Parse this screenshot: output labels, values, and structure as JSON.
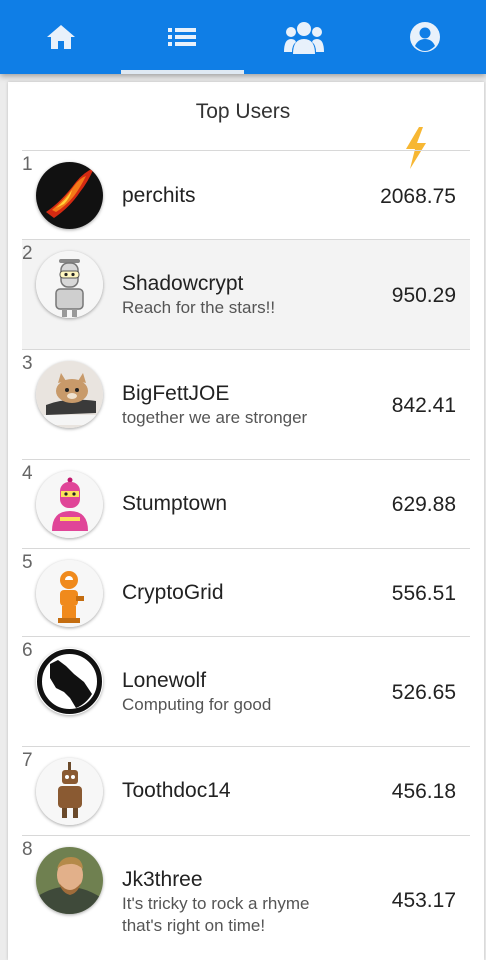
{
  "nav": {
    "tabs": [
      {
        "icon": "home-icon",
        "selected": false
      },
      {
        "icon": "list-icon",
        "selected": true
      },
      {
        "icon": "team-icon",
        "selected": false
      },
      {
        "icon": "account-icon",
        "selected": false
      }
    ]
  },
  "page": {
    "title": "Top Users",
    "score_column_icon": "lightning-icon"
  },
  "users": [
    {
      "rank": "1",
      "name": "perchits",
      "motto": "",
      "score": "2068.75",
      "avatar": "flame-avatar"
    },
    {
      "rank": "2",
      "name": "Shadowcrypt",
      "motto": "Reach for the stars!!",
      "score": "950.29",
      "avatar": "robot-avatar"
    },
    {
      "rank": "3",
      "name": "BigFettJOE",
      "motto": "together we are stronger",
      "score": "842.41",
      "avatar": "cat-avatar"
    },
    {
      "rank": "4",
      "name": "Stumptown",
      "motto": "",
      "score": "629.88",
      "avatar": "pink-robot-avatar"
    },
    {
      "rank": "5",
      "name": "CryptoGrid",
      "motto": "",
      "score": "556.51",
      "avatar": "orange-robot-avatar"
    },
    {
      "rank": "6",
      "name": "Lonewolf",
      "motto": "Computing for good",
      "score": "526.65",
      "avatar": "wolf-avatar"
    },
    {
      "rank": "7",
      "name": "Toothdoc14",
      "motto": "",
      "score": "456.18",
      "avatar": "brown-robot-avatar"
    },
    {
      "rank": "8",
      "name": "Jk3three",
      "motto": "It's tricky to rock a rhyme that's right on time!",
      "score": "453.17",
      "avatar": "photo-avatar"
    }
  ],
  "colors": {
    "primary": "#0f7ee6",
    "highlight_row": "#f3f3f3",
    "bolt": "#f7b733"
  }
}
